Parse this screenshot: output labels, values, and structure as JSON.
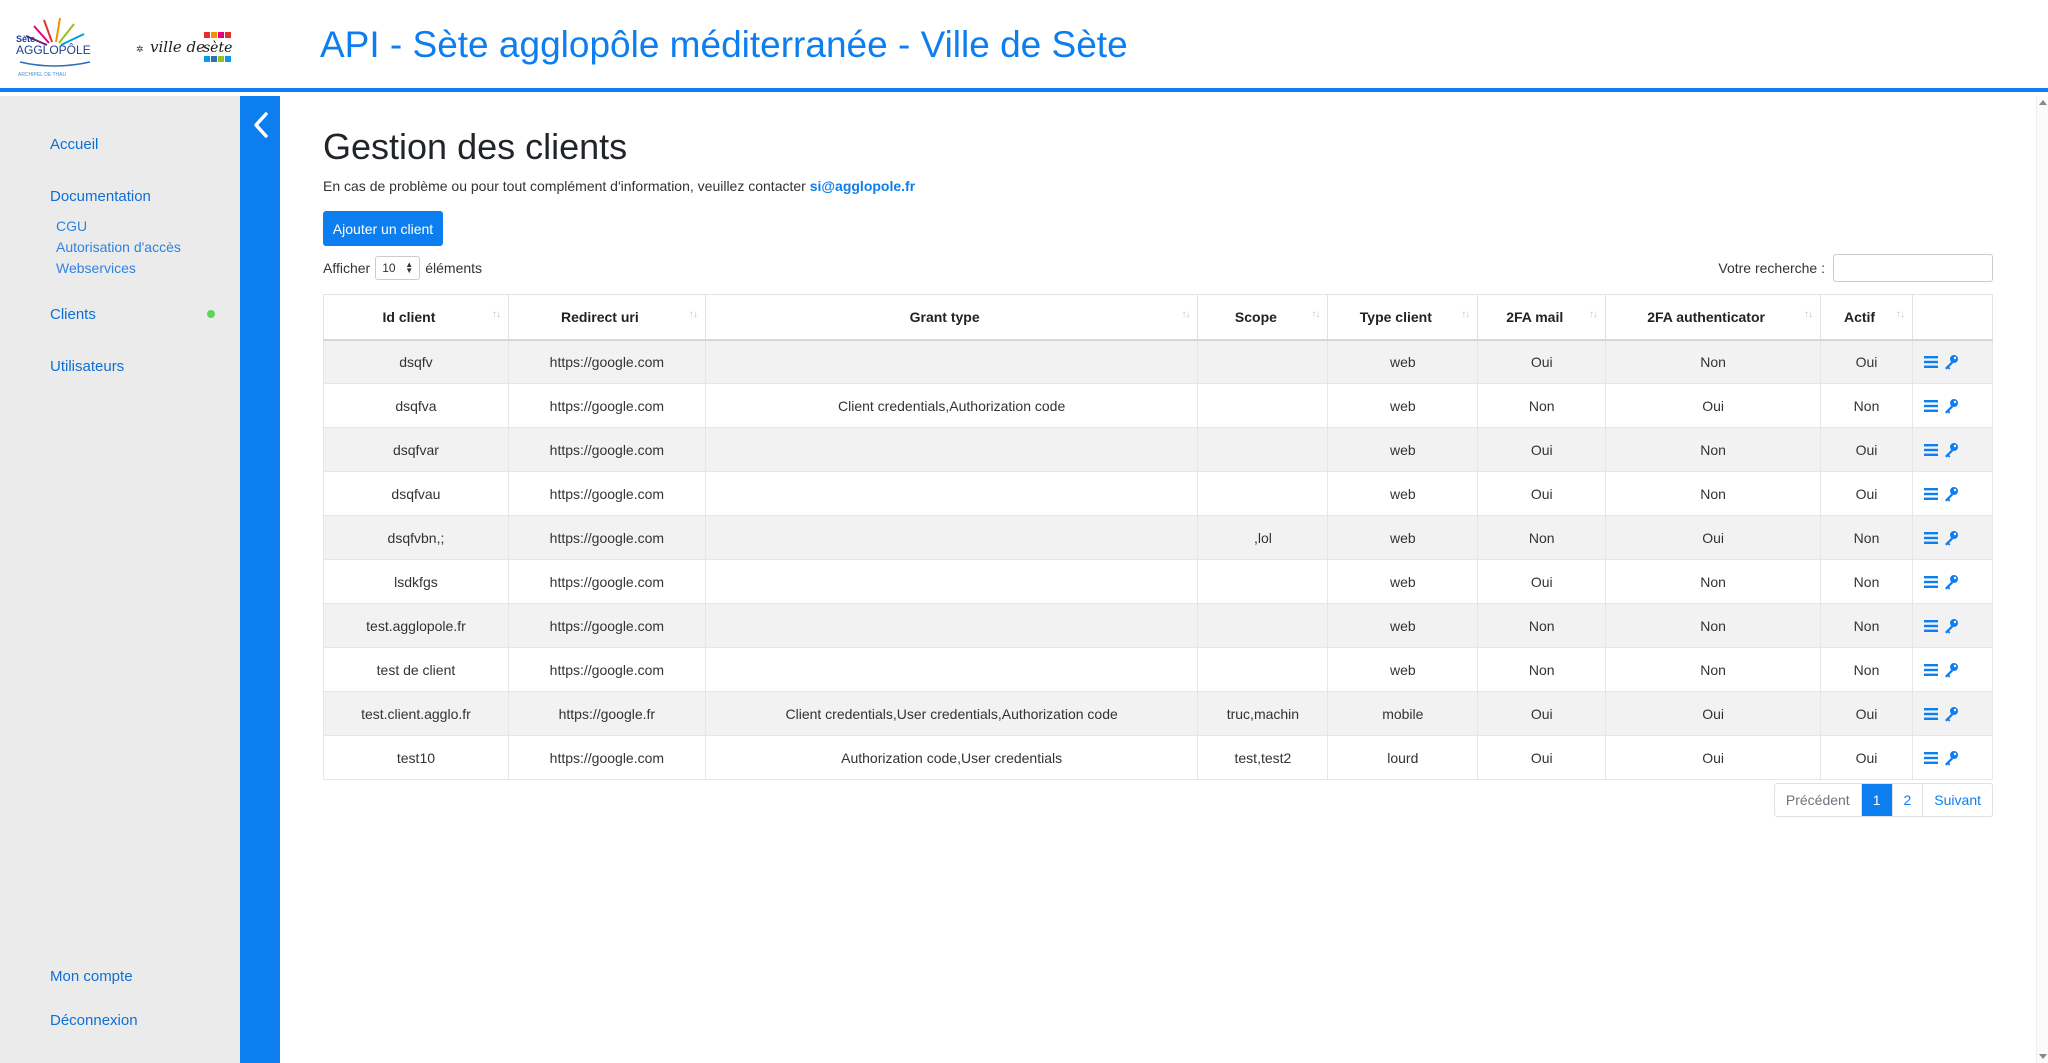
{
  "app": {
    "title": "API - Sète agglopôle méditerranée - Ville de Sète",
    "logo_agglo_text": [
      "Sète",
      "AGGLOPÔLE",
      "ARCHIPEL DE THAU"
    ],
    "logo_ville_text": "ville de sète"
  },
  "sidebar": {
    "home": "Accueil",
    "documentation": "Documentation",
    "doc_items": [
      "CGU",
      "Autorisation d'accès",
      "Webservices"
    ],
    "clients": "Clients",
    "users": "Utilisateurs",
    "account": "Mon compte",
    "logout": "Déconnexion",
    "active_dot_color": "#5fd35f"
  },
  "main": {
    "title": "Gestion des clients",
    "contact_text": "En cas de problème ou pour tout complément d'information, veuillez contacter ",
    "contact_email": "si@agglopole.fr",
    "add_button": "Ajouter un client",
    "show_label": "Afficher",
    "show_value": "10",
    "show_suffix": "éléments",
    "search_label": "Votre recherche :"
  },
  "table": {
    "columns": [
      "Id client",
      "Redirect uri",
      "Grant type",
      "Scope",
      "Type client",
      "2FA mail",
      "2FA authenticator",
      "Actif",
      ""
    ],
    "rows": [
      [
        "dsqfv",
        "https://google.com",
        "",
        "",
        "web",
        "Oui",
        "Non",
        "Oui"
      ],
      [
        "dsqfva",
        "https://google.com",
        "Client credentials,Authorization code",
        "",
        "web",
        "Non",
        "Oui",
        "Non"
      ],
      [
        "dsqfvar",
        "https://google.com",
        "",
        "",
        "web",
        "Oui",
        "Non",
        "Oui"
      ],
      [
        "dsqfvau",
        "https://google.com",
        "",
        "",
        "web",
        "Oui",
        "Non",
        "Oui"
      ],
      [
        "dsqfvbn,;",
        "https://google.com",
        "",
        ",lol",
        "web",
        "Non",
        "Oui",
        "Non"
      ],
      [
        "lsdkfgs",
        "https://google.com",
        "",
        "",
        "web",
        "Oui",
        "Non",
        "Non"
      ],
      [
        "test.agglopole.fr",
        "https://google.com",
        "",
        "",
        "web",
        "Non",
        "Non",
        "Non"
      ],
      [
        "test de client",
        "https://google.com",
        "",
        "",
        "web",
        "Non",
        "Non",
        "Non"
      ],
      [
        "test.client.agglo.fr",
        "https://google.fr",
        "Client credentials,User credentials,Authorization code",
        "truc,machin",
        "mobile",
        "Oui",
        "Oui",
        "Oui"
      ],
      [
        "test10",
        "https://google.com",
        "Authorization code,User credentials",
        "test,test2",
        "lourd",
        "Oui",
        "Oui",
        "Oui"
      ]
    ],
    "row_icons": [
      "list-icon",
      "key-icon"
    ]
  },
  "pagination": {
    "prev": "Précédent",
    "pages": [
      "1",
      "2"
    ],
    "active_page": "1",
    "next": "Suivant"
  },
  "colors": {
    "accent": "#0d7ef0",
    "sidebar_bg": "#ebebeb"
  }
}
